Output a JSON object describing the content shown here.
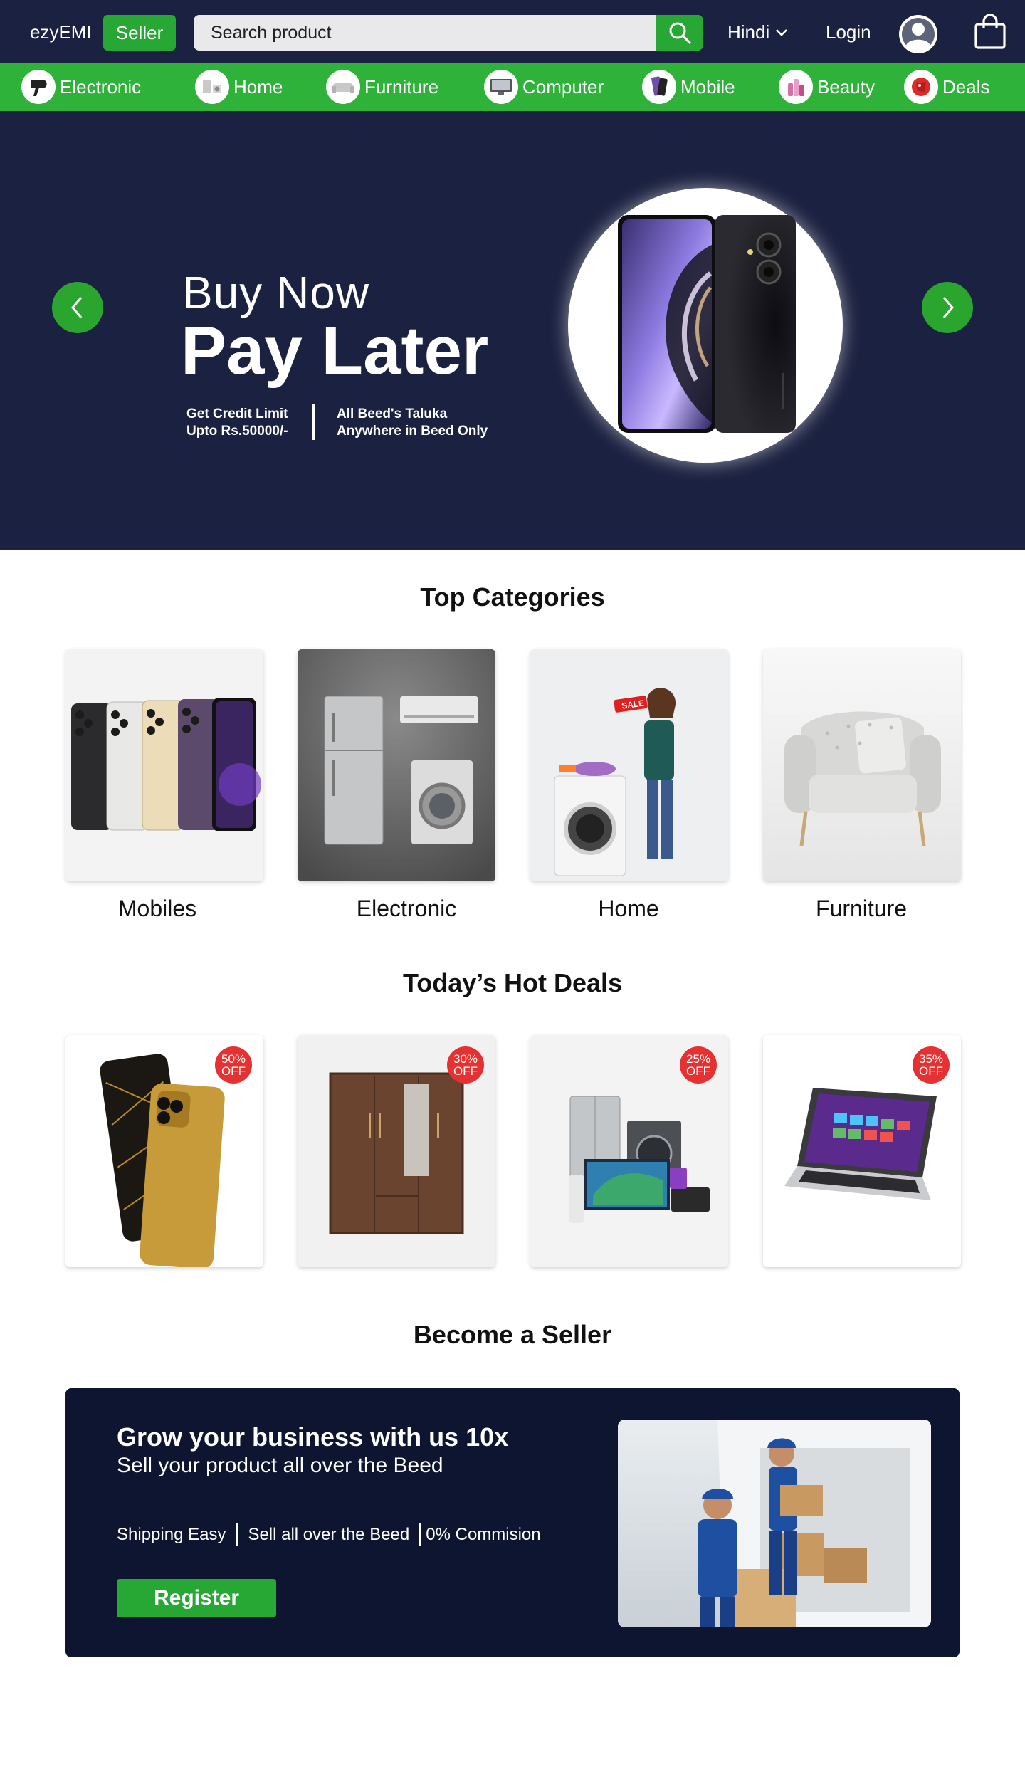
{
  "header": {
    "logo": "ezyEMI",
    "seller_label": "Seller",
    "search_placeholder": "Search product",
    "language": "Hindi",
    "login_label": "Login"
  },
  "categories_nav": [
    {
      "label": "Electronic",
      "icon": "hair-dryer-icon"
    },
    {
      "label": "Home",
      "icon": "home-appliance-icon"
    },
    {
      "label": "Furniture",
      "icon": "sofa-icon"
    },
    {
      "label": "Computer",
      "icon": "desktop-computer-icon"
    },
    {
      "label": "Mobile",
      "icon": "smartphone-icon"
    },
    {
      "label": "Beauty",
      "icon": "beauty-products-icon"
    },
    {
      "label": "Deals",
      "icon": "deals-icon"
    }
  ],
  "hero": {
    "line1": "Buy Now",
    "line2": "Pay Later",
    "note1_line1": "Get Credit Limit",
    "note1_line2": "Upto Rs.50000/-",
    "note2_line1": "All Beed's Taluka",
    "note2_line2": "Anywhere in Beed Only"
  },
  "top_categories": {
    "title": "Top Categories",
    "items": [
      {
        "label": "Mobiles",
        "image": "smartphones-lineup"
      },
      {
        "label": "Electronic",
        "image": "fridge-ac-washer"
      },
      {
        "label": "Home",
        "image": "woman-with-washing-machine-sale"
      },
      {
        "label": "Furniture",
        "image": "armchair"
      }
    ]
  },
  "hot_deals": {
    "title": "Today’s Hot Deals",
    "items": [
      {
        "discount": "50%",
        "off": "OFF",
        "image": "gold-iphone"
      },
      {
        "discount": "30%",
        "off": "OFF",
        "image": "wooden-wardrobe"
      },
      {
        "discount": "25%",
        "off": "OFF",
        "image": "home-appliances-bundle"
      },
      {
        "discount": "35%",
        "off": "OFF",
        "image": "laptop"
      }
    ]
  },
  "seller": {
    "title": "Become a Seller",
    "headline": "Grow your business with us 10x",
    "subline": "Sell your product all over the Beed",
    "features": [
      "Shipping Easy",
      "Sell all over the Beed",
      "0% Commision"
    ],
    "register_label": "Register"
  },
  "colors": {
    "navy": "#1b2140",
    "green": "#2fb23a",
    "button_green": "#27a834",
    "badge_red": "#e53131",
    "seller_bg": "#0d1530"
  }
}
